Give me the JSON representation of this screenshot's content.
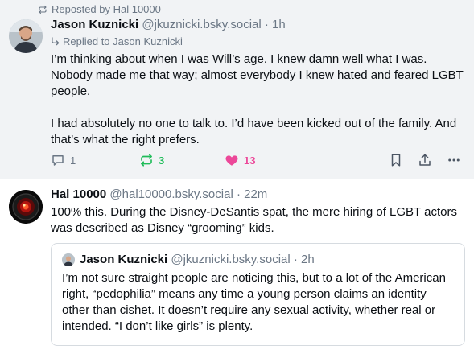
{
  "post1": {
    "repost_label": "Reposted by Hal 10000",
    "author_name": "Jason Kuznicki",
    "author_handle": "@jkuznicki.bsky.social",
    "time_sep": " · ",
    "time": "1h",
    "reply_label": "Replied to Jason Kuznicki",
    "paragraph1": "I’m thinking about when I was Will’s age. I knew damn well what I was. Nobody made me that way; almost everybody I knew hated and feared LGBT people.",
    "paragraph2": "I had absolutely no one to talk to. I’d have been kicked out of the family. And that’s what the right prefers.",
    "counts": {
      "replies": "1",
      "reposts": "3",
      "likes": "13"
    }
  },
  "post2": {
    "author_name": "Hal 10000",
    "author_handle": "@hal10000.bsky.social",
    "time_sep": " · ",
    "time": "22m",
    "text": "100% this. During the Disney-DeSantis spat, the mere hiring of LGBT actors was described as Disney “grooming” kids.",
    "quote": {
      "author_name": "Jason Kuznicki",
      "author_handle": "@jkuznicki.bsky.social",
      "time_sep": " · ",
      "time": "2h",
      "text": "I’m not sure straight people are noticing this, but to a lot of the American right, “pedophilia” means any time a young person claims an identity other than cishet. It doesn’t require any sexual activity, whether real or intended. “I don’t like girls” is plenty."
    }
  },
  "icons": {
    "repost": "repost-icon",
    "reply_arrow": "reply-arrow-icon",
    "reply": "reply-icon",
    "like": "heart-icon",
    "bookmark": "bookmark-icon",
    "share": "share-icon",
    "more": "more-icon"
  },
  "colors": {
    "repost_active": "#20bc5a",
    "like_active": "#ec4899",
    "muted": "#6b7785",
    "highlight_bg": "#f1f3f5"
  }
}
